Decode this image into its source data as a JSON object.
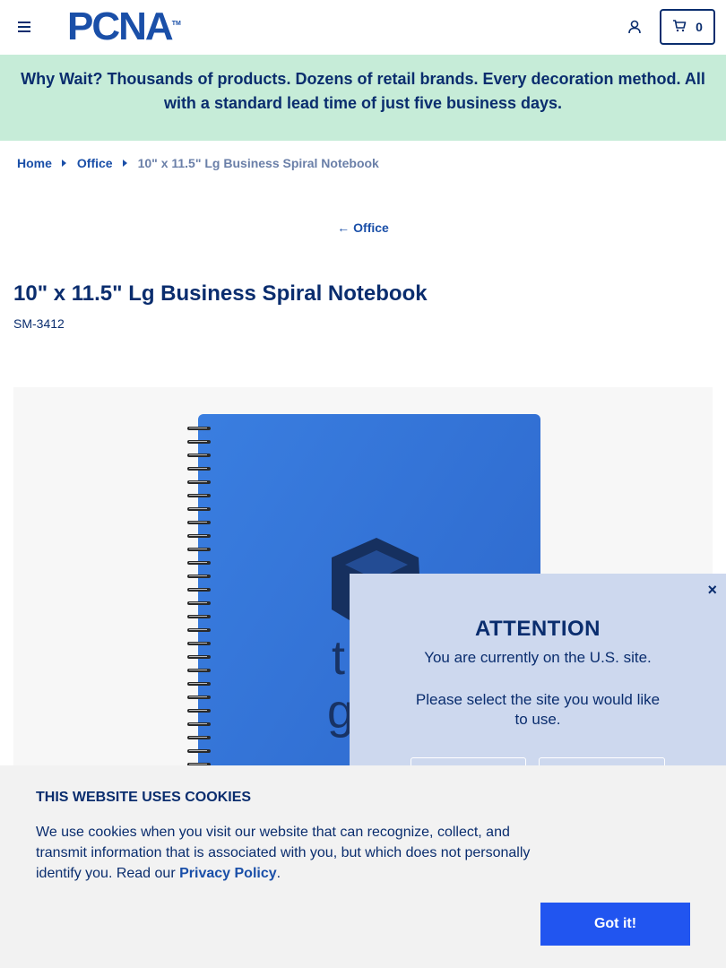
{
  "header": {
    "logo_text": "PCNA",
    "logo_tm": "TM",
    "cart_count": "0",
    "icons": [
      "menu-icon",
      "user-icon",
      "cart-icon"
    ]
  },
  "banner": {
    "text": "Why Wait? Thousands of products. Dozens of retail brands. Every decoration method. All with a standard lead time of just five business days."
  },
  "breadcrumb": {
    "items": [
      {
        "label": "Home"
      },
      {
        "label": "Office"
      }
    ],
    "current": "10\" x 11.5\" Lg Business Spiral Notebook"
  },
  "back_link": {
    "label": "Office"
  },
  "product": {
    "title": "10\" x 11.5\" Lg Business Spiral Notebook",
    "sku": "SM-3412",
    "notebook_color": "#2f6fd6"
  },
  "site_popup": {
    "close": "×",
    "heading": "ATTENTION",
    "line1": "You are currently on the U.S. site.",
    "line2": "Please select the site you would like to use."
  },
  "cookie": {
    "heading": "THIS WEBSITE USES COOKIES",
    "body": "We use cookies when you visit our website that can recognize, collect, and transmit information that is associated with you, but which does not personally identify you. Read our",
    "link": "Privacy Policy",
    "period": ".",
    "button": "Got it!"
  },
  "colors": {
    "brand_navy": "#0a2d6e",
    "brand_blue": "#1a4fa8",
    "banner_bg": "#c6ecd8",
    "popup_bg": "#cdd8ee",
    "button_bg": "#2155f0"
  }
}
